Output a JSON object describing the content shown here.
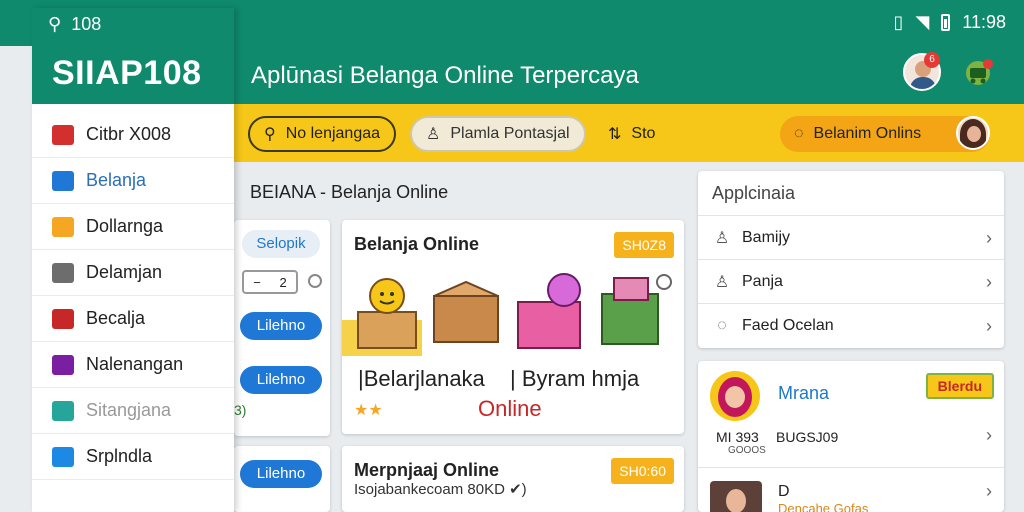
{
  "status_bar": {
    "left_time": "108",
    "right_time": "11:98"
  },
  "drawer": {
    "brand": "SIIAP108",
    "items": [
      {
        "label": "Citbr X008",
        "icon": "store-icon",
        "color": "#d32f2f"
      },
      {
        "label": "Belanja",
        "icon": "home-icon",
        "color": "#1f78d6"
      },
      {
        "label": "Dollarnga",
        "icon": "wallet-icon",
        "color": "#f5a623"
      },
      {
        "label": "Delamjan",
        "icon": "shop-icon",
        "color": "#6d6d6d"
      },
      {
        "label": "Becalja",
        "icon": "gift-icon",
        "color": "#c62828"
      },
      {
        "label": "Nalenangan",
        "icon": "tag-icon",
        "color": "#7b1fa2"
      },
      {
        "label": "Sitangjana",
        "icon": "bag-icon",
        "color": "#26a69a"
      },
      {
        "label": "Srplndla",
        "icon": "box-icon",
        "color": "#1e88e5"
      }
    ]
  },
  "header": {
    "title": "Aplūnasi Belanga Online Terpercaya",
    "notification_count": "6"
  },
  "toolbar": {
    "pill1_label": "No lenjangaa",
    "pill2_label": "Plamla Pontasjal",
    "pill3_label": "Sto",
    "pill4_label": "Belanim Onlins"
  },
  "main": {
    "section_title": "BEIANA - Belanja Online",
    "left_chip": "Selopik",
    "stepper_value": "2",
    "left_buttons": [
      "Lilehno",
      "Lilehno",
      "Lilehno"
    ],
    "left_rating": "3)",
    "product1": {
      "title": "Belanja Online",
      "price": "SH0Z8",
      "name_a": "|Belarjlanaka",
      "name_b": "| Byram hmja",
      "online": "Online",
      "stars": "★★"
    },
    "product2": {
      "title": "Merpnjaaj Online",
      "price": "SH0:60",
      "subtitle": "Isojabankecoam 80KD ✔)"
    }
  },
  "side_menu": {
    "header": "Applcinaia",
    "rows": [
      {
        "label": "Bamijy",
        "icon": "person-icon"
      },
      {
        "label": "Panja",
        "icon": "person-icon"
      },
      {
        "label": "Faed Ocelan",
        "icon": "chat-icon"
      }
    ]
  },
  "user_card": {
    "name": "Mrana",
    "button": "Blerdu",
    "code1": "MI 393",
    "code1_sub": "GOOOS",
    "code2": "BUGSJ09",
    "user2_name": "D",
    "user2_sub": "Dencahe Gofas"
  }
}
